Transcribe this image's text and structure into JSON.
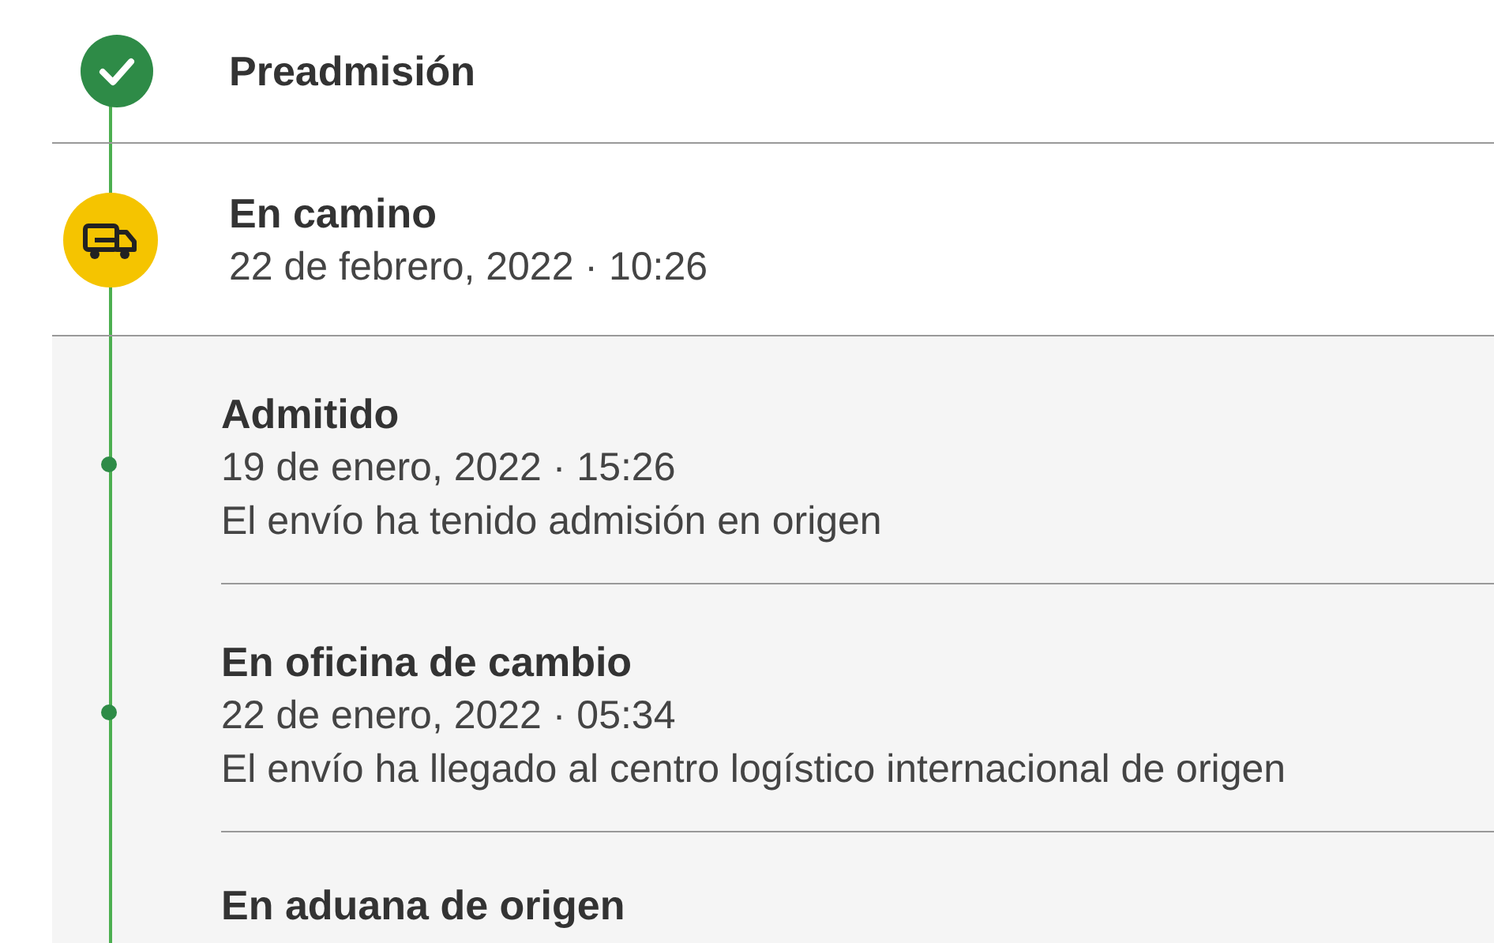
{
  "steps": [
    {
      "kind": "done",
      "title": "Preadmisión"
    },
    {
      "kind": "current",
      "title": "En camino",
      "date": "22 de febrero, 2022 · 10:26"
    }
  ],
  "events": [
    {
      "title": "Admitido",
      "date": "19 de enero, 2022 · 15:26",
      "description": "El envío ha tenido admisión en origen"
    },
    {
      "title": "En oficina de cambio",
      "date": "22 de enero, 2022 · 05:34",
      "description": "El envío ha llegado al centro logístico internacional de origen"
    },
    {
      "title": "En aduana de origen"
    }
  ]
}
